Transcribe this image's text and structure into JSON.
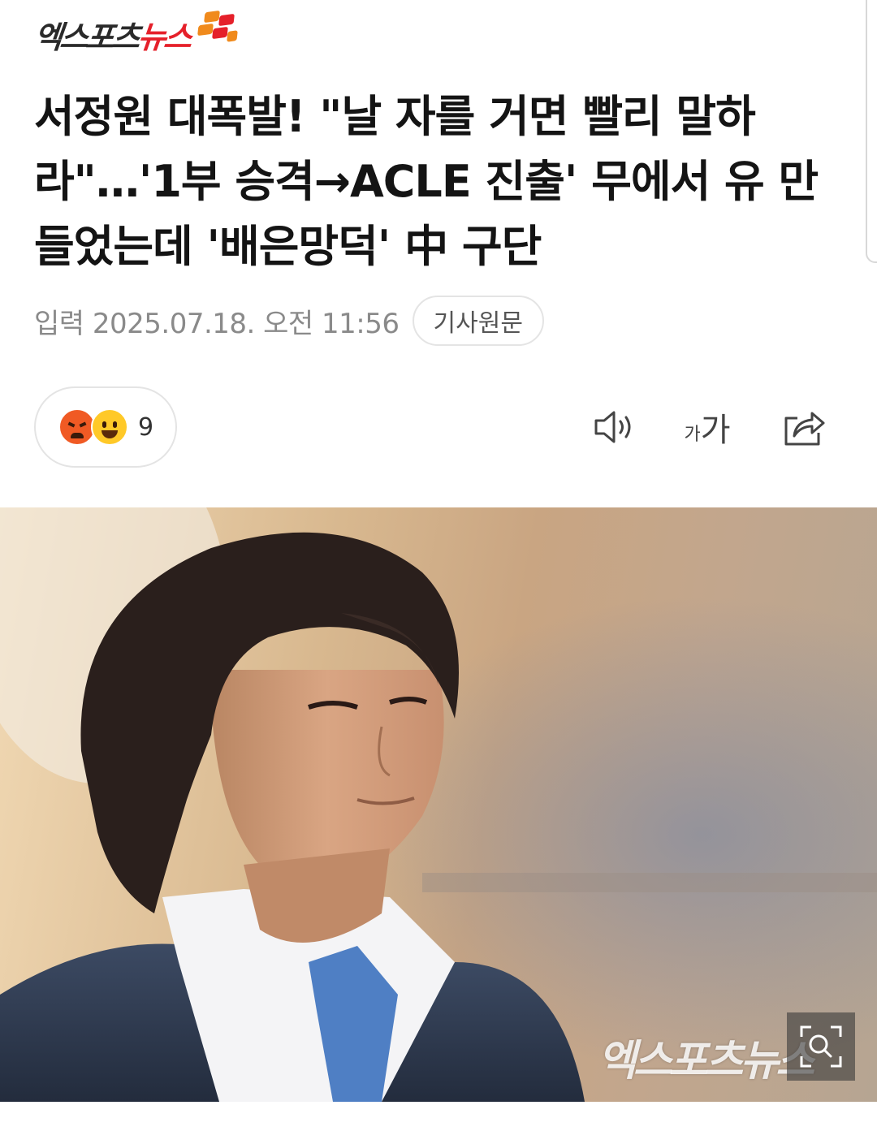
{
  "header": {
    "logo_text_dark": "엑스포츠",
    "logo_text_red": "뉴스"
  },
  "article": {
    "headline": "서정원 대폭발! \"날 자를 거면 빨리 말하라\"…'1부 승격→ACLE 진출' 무에서 유 만들었는데 '배은망덕' 中 구단",
    "published": "입력 2025.07.18. 오전 11:56",
    "original_button": "기사원문"
  },
  "reactions": {
    "emojis": [
      "angry-face",
      "happy-face"
    ],
    "count": "9"
  },
  "toolbar": {
    "tts_icon": "speaker-icon",
    "font_small_label": "가",
    "font_large_label": "가",
    "share_icon": "share-icon"
  },
  "photo": {
    "watermark": "엑스포츠뉴스",
    "zoom_icon": "zoom-icon"
  },
  "colors": {
    "brand_red": "#e5202a",
    "brand_orange": "#f08a1c",
    "meta_gray": "#8a8a8a",
    "angry_emoji": "#f05a24",
    "happy_emoji": "#ffc928"
  }
}
